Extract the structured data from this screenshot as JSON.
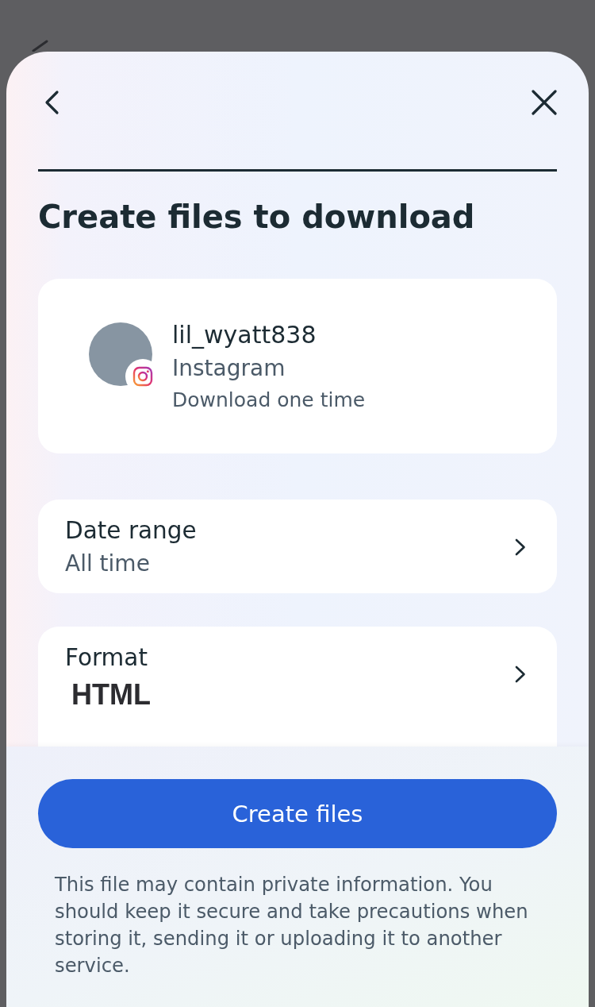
{
  "title": "Create files to download",
  "account": {
    "username": "lil_wyatt838",
    "platform": "Instagram",
    "frequency": "Download one time"
  },
  "settings": [
    {
      "kind": "plain",
      "rows": [
        {
          "label": "Date range",
          "value": "All time"
        }
      ]
    },
    {
      "kind": "strong",
      "rows": [
        {
          "label": "Format",
          "value": "HTML"
        }
      ]
    }
  ],
  "footer": {
    "button": "Create files",
    "notice": "This file may contain private information. You should keep it secure and take precautions when storing it, sending it or uploading it to another service."
  }
}
